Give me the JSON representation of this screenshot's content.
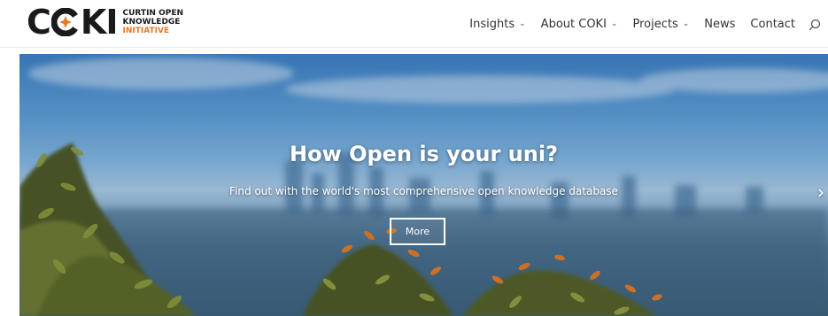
{
  "brand": {
    "logo_text_c1": "C",
    "logo_text_rest": "KI",
    "line1": "CURTIN OPEN",
    "line2": "KNOWLEDGE",
    "line3": "INITIATIVE",
    "accent_color": "#e87722"
  },
  "nav": {
    "items": [
      {
        "label": "Insights",
        "has_dropdown": true
      },
      {
        "label": "About COKI",
        "has_dropdown": true
      },
      {
        "label": "Projects",
        "has_dropdown": true
      },
      {
        "label": "News",
        "has_dropdown": false
      },
      {
        "label": "Contact",
        "has_dropdown": false
      }
    ],
    "search_icon": "search-icon"
  },
  "hero": {
    "title": "How Open is your uni?",
    "subtitle": "Find out with the world's most comprehensive open knowledge database",
    "button_label": "More",
    "next_arrow": "›"
  }
}
